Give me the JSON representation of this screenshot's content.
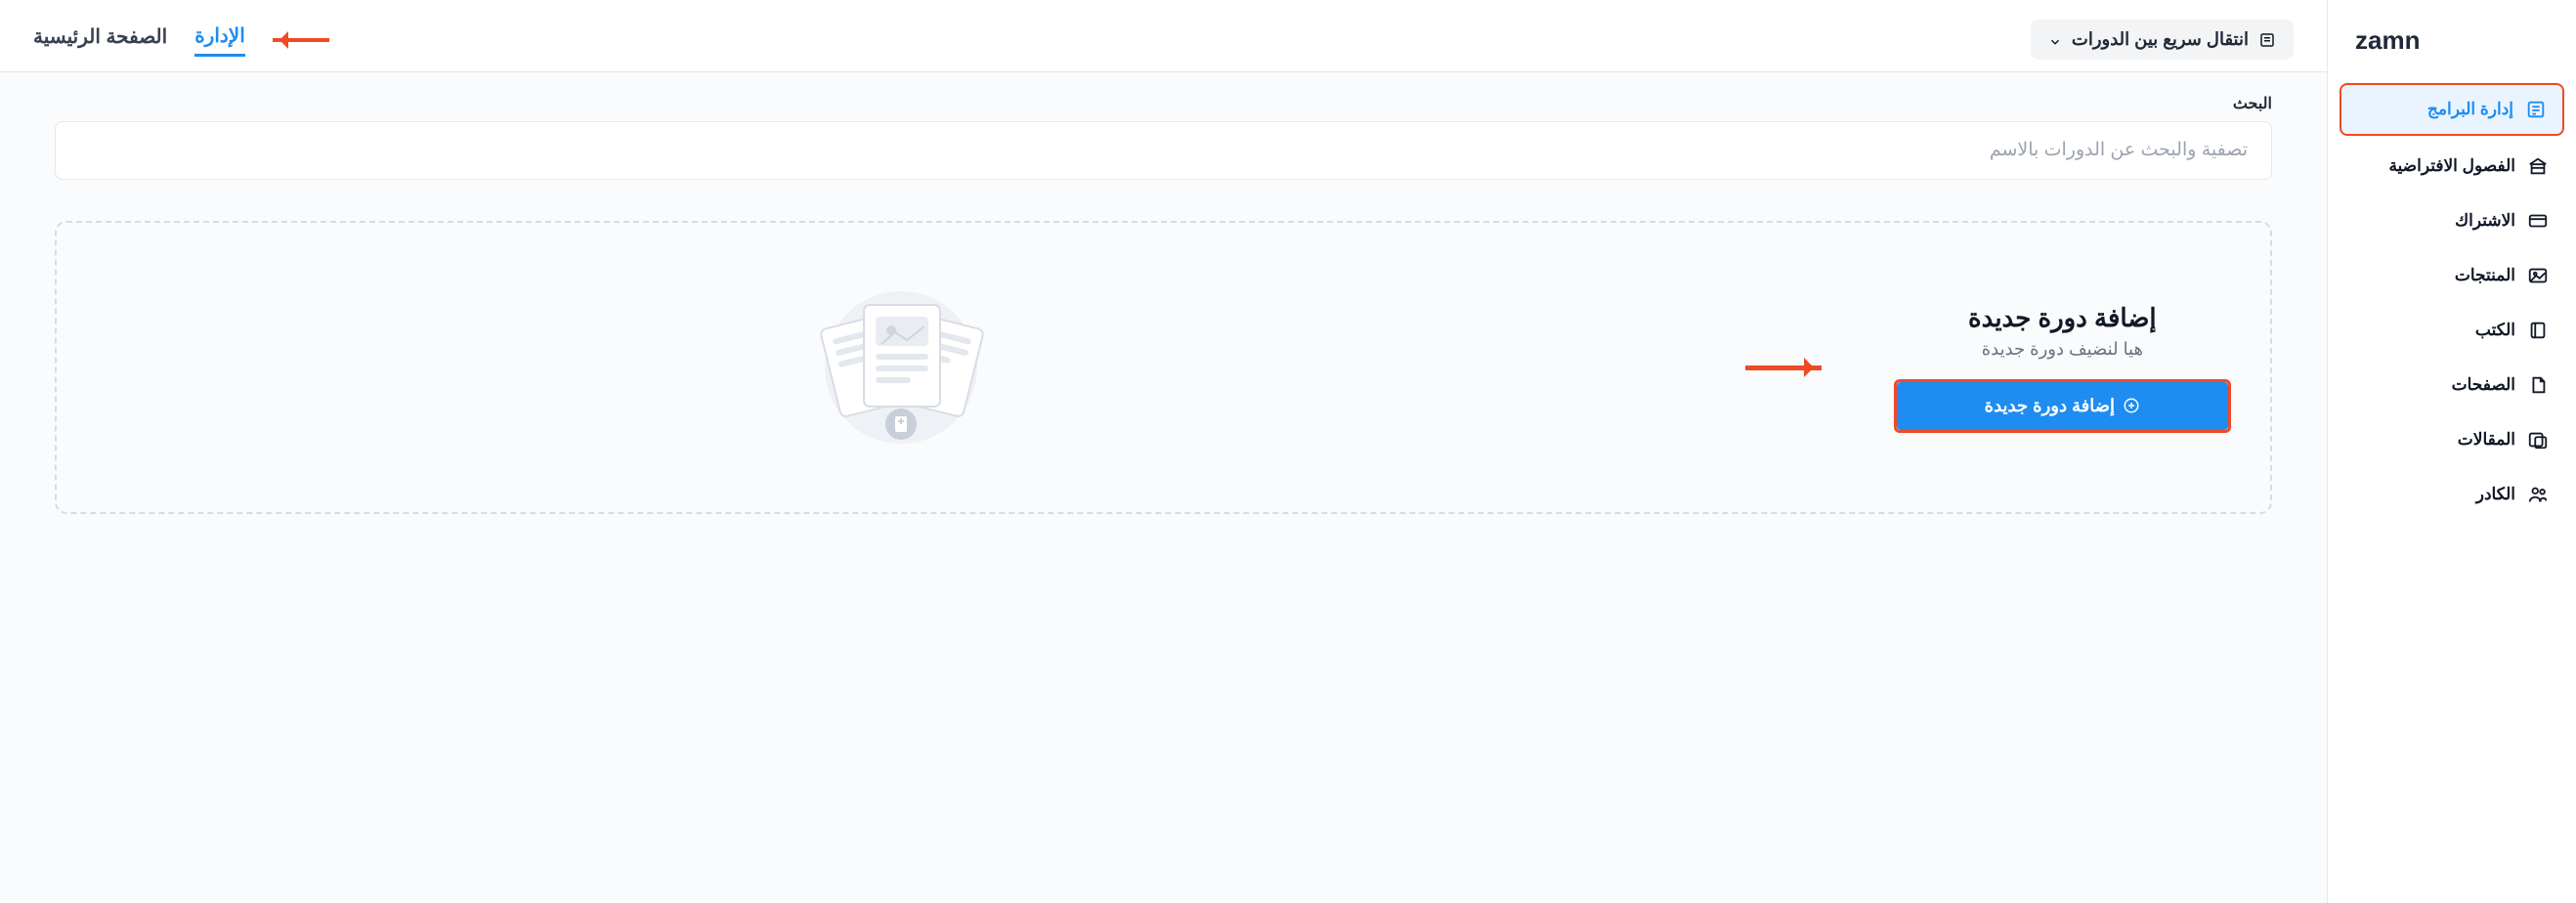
{
  "brand": "zamn",
  "sidebar": {
    "items": [
      {
        "label": "إدارة البرامج"
      },
      {
        "label": "الفصول الافتراضية"
      },
      {
        "label": "الاشتراك"
      },
      {
        "label": "المنتجات"
      },
      {
        "label": "الكتب"
      },
      {
        "label": "الصفحات"
      },
      {
        "label": "المقالات"
      },
      {
        "label": "الكادر"
      }
    ]
  },
  "topbar": {
    "quick_switch": "انتقال سريع بين الدورات",
    "tabs": {
      "manage": "الإدارة",
      "home": "الصفحة الرئيسية"
    }
  },
  "search": {
    "label": "البحث",
    "placeholder": "تصفية والبحث عن الدورات بالاسم"
  },
  "empty": {
    "title": "إضافة دورة جديدة",
    "subtitle": "هيا لنضيف دورة جديدة",
    "button": "إضافة دورة جديدة"
  }
}
